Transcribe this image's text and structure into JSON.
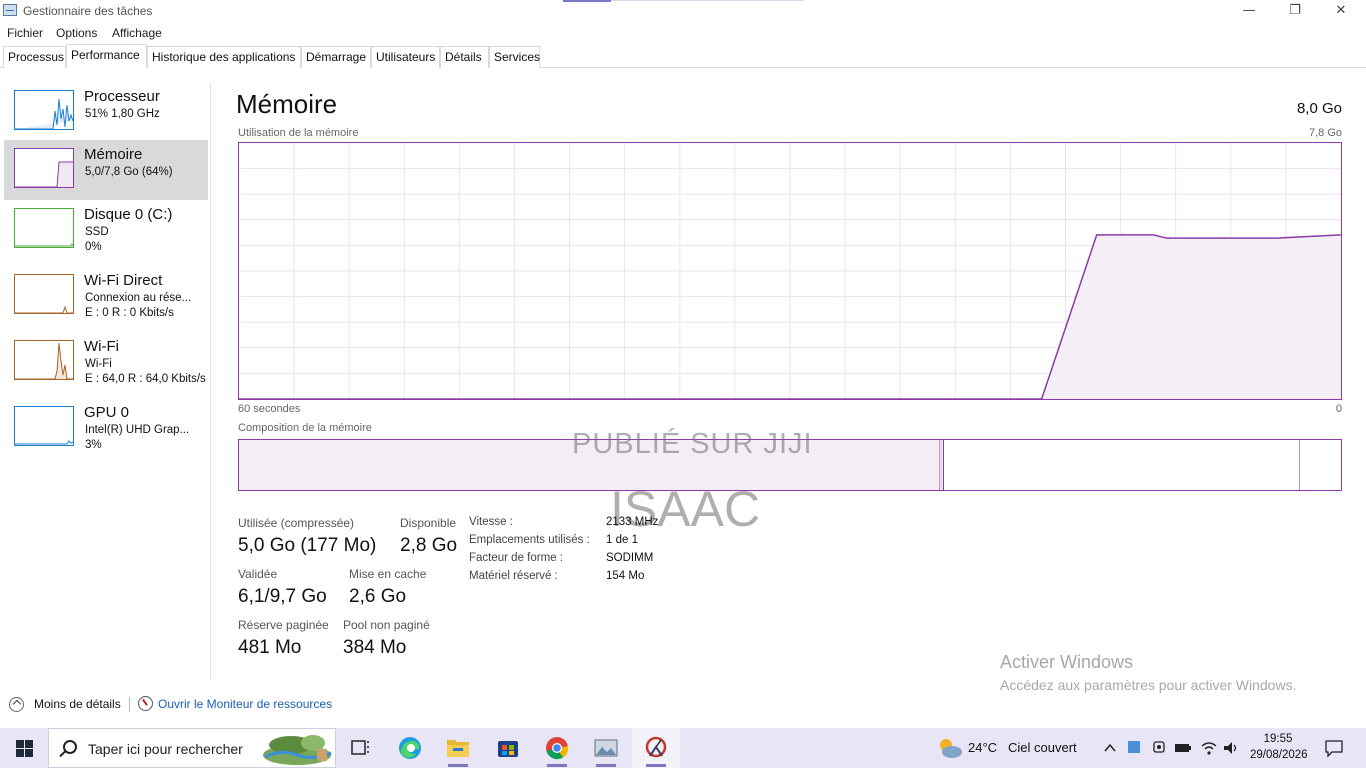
{
  "window": {
    "title": "Gestionnaire des tâches",
    "controls": {
      "minimize": "—",
      "restore": "❐",
      "close": "✕"
    }
  },
  "menu": [
    "Fichier",
    "Options",
    "Affichage"
  ],
  "tabs": [
    "Processus",
    "Performance",
    "Historique des applications",
    "Démarrage",
    "Utilisateurs",
    "Détails",
    "Services"
  ],
  "active_tab": "Performance",
  "sidebar": {
    "items": [
      {
        "name": "Processeur",
        "lines": [
          "51% 1,80 GHz"
        ],
        "color": "#1a7fd1",
        "selected": false
      },
      {
        "name": "Mémoire",
        "lines": [
          "5,0/7,8 Go (64%)"
        ],
        "color": "#8b3aa7",
        "selected": true
      },
      {
        "name": "Disque 0 (C:)",
        "lines": [
          "SSD",
          "0%"
        ],
        "color": "#4da83a",
        "selected": false
      },
      {
        "name": "Wi-Fi Direct",
        "lines": [
          "Connexion au rése...",
          "E : 0 R : 0 Kbits/s"
        ],
        "color": "#a7652a",
        "selected": false
      },
      {
        "name": "Wi-Fi",
        "lines": [
          "Wi-Fi",
          "E : 64,0 R : 64,0 Kbits/s"
        ],
        "color": "#a7652a",
        "selected": false
      },
      {
        "name": "GPU 0",
        "lines": [
          "Intel(R) UHD Grap...",
          "3%"
        ],
        "color": "#1a7fd1",
        "selected": false
      }
    ]
  },
  "main": {
    "title": "Mémoire",
    "total": "8,0 Go",
    "usage_label": "Utilisation de la mémoire",
    "usage_max": "7,8 Go",
    "time_label": "60 secondes",
    "time_end": "0",
    "composition_label": "Composition de la mémoire",
    "accent_color": "#8b3aa7"
  },
  "chart_data": {
    "type": "area",
    "title": "Utilisation de la mémoire",
    "xlabel": "60 secondes",
    "ylabel": "",
    "xlim": [
      60,
      0
    ],
    "ylim": [
      0,
      7.8
    ],
    "unit": "Go",
    "x": [
      60,
      16.3,
      13.3,
      10.2,
      9.5,
      6.5,
      3.5,
      0
    ],
    "values": [
      0,
      0,
      5.0,
      5.0,
      4.9,
      4.9,
      4.9,
      5.0
    ],
    "grid": true
  },
  "stats": {
    "used_label": "Utilisée (compressée)",
    "used_value": "5,0 Go (177 Mo)",
    "available_label": "Disponible",
    "available_value": "2,8 Go",
    "committed_label": "Validée",
    "committed_value": "6,1/9,7 Go",
    "cached_label": "Mise en cache",
    "cached_value": "2,6 Go",
    "paged_label": "Réserve paginée",
    "paged_value": "481 Mo",
    "nonpaged_label": "Pool non paginé",
    "nonpaged_value": "384 Mo"
  },
  "details": [
    {
      "key": "Vitesse :",
      "value": "2133 MHz"
    },
    {
      "key": "Emplacements utilisés :",
      "value": "1 de 1"
    },
    {
      "key": "Facteur de forme :",
      "value": "SODIMM"
    },
    {
      "key": "Matériel réservé :",
      "value": "154 Mo"
    }
  ],
  "watermark": {
    "line1": "PUBLIÉ SUR JIJI",
    "line2": "ISAAC"
  },
  "activation": {
    "title": "Activer Windows",
    "subtitle": "Accédez aux paramètres pour activer Windows."
  },
  "bottom": {
    "less_details": "Moins de détails",
    "resource_monitor": "Ouvrir le Moniteur de ressources"
  },
  "taskbar": {
    "search_placeholder": "Taper ici pour rechercher",
    "weather_temp": "24°C",
    "weather_desc": "Ciel couvert",
    "time": "19:55",
    "date": "29/08/2026"
  }
}
